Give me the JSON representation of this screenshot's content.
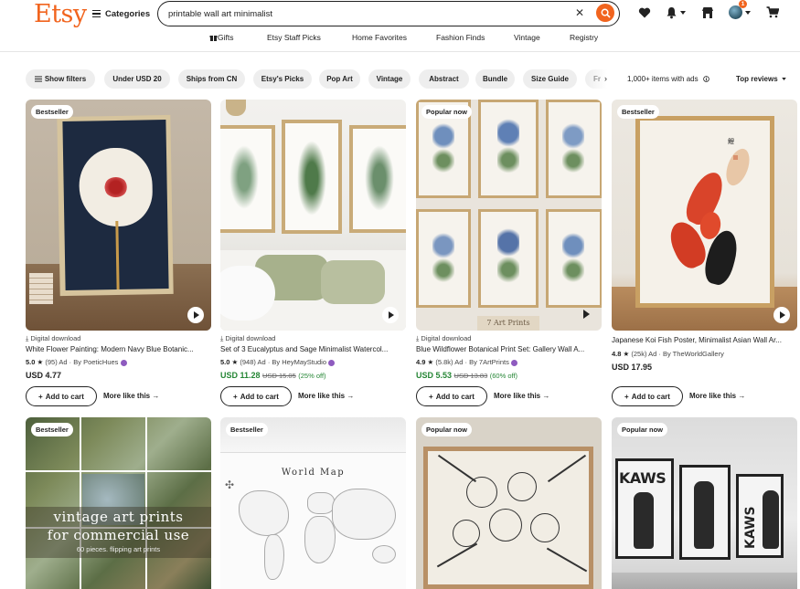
{
  "header": {
    "logo": "Etsy",
    "categories": "Categories",
    "search": {
      "value": "printable wall art minimalist"
    },
    "cart_badge": "1",
    "subnav": [
      "Gifts",
      "Etsy Staff Picks",
      "Home Favorites",
      "Fashion Finds",
      "Vintage",
      "Registry"
    ]
  },
  "filters": {
    "chips": [
      "Show filters",
      "Under USD 20",
      "Ships from CN",
      "Etsy's Picks",
      "Pop Art",
      "Vintage",
      "Abstract",
      "Bundle",
      "Size Guide",
      "Fr"
    ],
    "items_count": "1,000+ items with ads",
    "sort": "Top reviews"
  },
  "cards": [
    {
      "tag": "Bestseller",
      "download": "Digital download",
      "title": "White Flower Painting: Modern Navy Blue Botanic...",
      "rating": "5.0",
      "reviews": "(95)",
      "ad": "Ad",
      "by": "By PoeticHues",
      "price": "USD 4.77",
      "old_price": "",
      "discount": "",
      "add_to_cart": "Add to cart",
      "more": "More like this"
    },
    {
      "tag": "",
      "download": "Digital download",
      "title": "Set of 3 Eucalyptus and Sage Minimalist Watercol...",
      "rating": "5.0",
      "reviews": "(948)",
      "ad": "Ad",
      "by": "By HeyMayStudio",
      "price": "USD 11.28",
      "old_price": "USD 15.05",
      "discount": "(25% off)",
      "add_to_cart": "Add to cart",
      "more": "More like this"
    },
    {
      "tag": "Popular now",
      "download": "Digital download",
      "title": "Blue Wildflower Botanical Print Set: Gallery Wall A...",
      "rating": "4.9",
      "reviews": "(5.8k)",
      "ad": "Ad",
      "by": "By 7ArtPrints",
      "price": "USD 5.53",
      "old_price": "USD 13.83",
      "discount": "(60% off)",
      "add_to_cart": "Add to cart",
      "more": "More like this",
      "image_caption": "7 Art Prints"
    },
    {
      "tag": "Bestseller",
      "download": "",
      "title": "Japanese Koi Fish Poster, Minimalist Asian Wall Ar...",
      "rating": "4.8",
      "reviews": "(25k)",
      "ad": "Ad",
      "by": "By TheWorldGallery",
      "price": "USD 17.95",
      "old_price": "",
      "discount": "",
      "add_to_cart": "Add to cart",
      "more": "More like this"
    },
    {
      "tag": "Bestseller",
      "image_text_1": "vintage art prints",
      "image_text_2": "for commercial use",
      "image_text_3": "60 pieces. flipping art prints"
    },
    {
      "tag": "Bestseller",
      "image_text_1": "World Map"
    },
    {
      "tag": "Popular now"
    },
    {
      "tag": "Popular now",
      "image_text_1": "KAWS",
      "image_text_2": "KAWS"
    }
  ],
  "colors": {
    "brand": "#F1641E",
    "sale": "#258635",
    "chip_bg": "#eeeeee"
  }
}
